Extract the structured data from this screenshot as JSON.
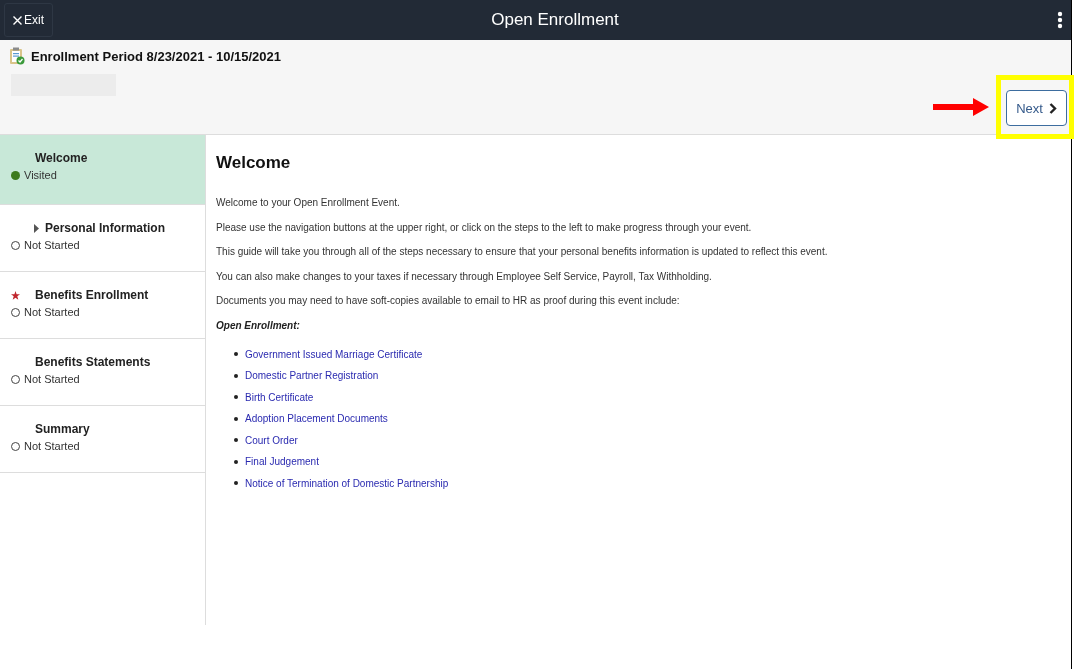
{
  "header": {
    "exit_label": "Exit",
    "title": "Open Enrollment"
  },
  "period": {
    "title": "Enrollment Period 8/23/2021 - 10/15/2021"
  },
  "next_button": {
    "label": "Next"
  },
  "steps": [
    {
      "title": "Welcome",
      "status": "Visited",
      "kind": "visited",
      "selected": true,
      "required": false,
      "expandable": false
    },
    {
      "title": "Personal Information",
      "status": "Not Started",
      "kind": "not_started",
      "selected": false,
      "required": false,
      "expandable": true
    },
    {
      "title": "Benefits Enrollment",
      "status": "Not Started",
      "kind": "not_started",
      "selected": false,
      "required": true,
      "expandable": false
    },
    {
      "title": "Benefits Statements",
      "status": "Not Started",
      "kind": "not_started",
      "selected": false,
      "required": false,
      "expandable": false
    },
    {
      "title": "Summary",
      "status": "Not Started",
      "kind": "not_started",
      "selected": false,
      "required": false,
      "expandable": false
    }
  ],
  "content": {
    "heading": "Welcome",
    "paragraphs": [
      "Welcome to your Open Enrollment Event.",
      "Please use the navigation buttons at the upper right, or click on the steps to the left to make progress through your event.",
      "This guide will take you through all of the steps necessary to ensure that your personal benefits information is updated to reflect this event.",
      "You can also make changes to your taxes if necessary through Employee Self Service, Payroll, Tax Withholding.",
      "Documents you may need to have soft-copies available to email to HR as proof during this event include:"
    ],
    "list_heading": "Open Enrollment:",
    "links": [
      "Government Issued Marriage Certificate",
      "Domestic Partner Registration",
      "Birth Certificate",
      "Adoption Placement Documents",
      "Court Order",
      "Final Judgement",
      "Notice of Termination of Domestic Partnership"
    ]
  }
}
